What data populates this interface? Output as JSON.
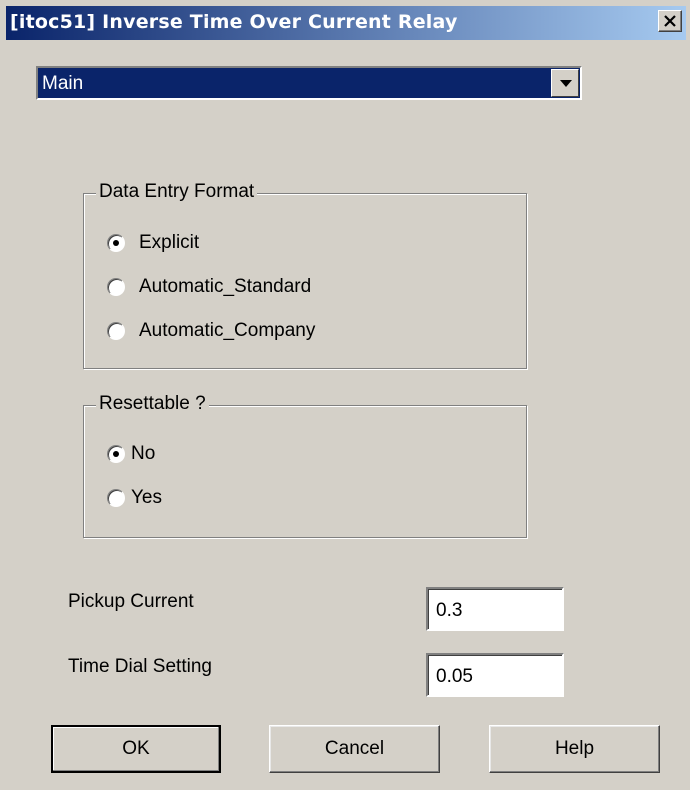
{
  "window": {
    "title": "[itoc51] Inverse Time Over Current Relay"
  },
  "page_selector": {
    "value": "Main"
  },
  "data_entry_format": {
    "label": "Data Entry Format",
    "options": [
      {
        "label": "Explicit",
        "checked": true
      },
      {
        "label": "Automatic_Standard",
        "checked": false
      },
      {
        "label": "Automatic_Company",
        "checked": false
      }
    ]
  },
  "resettable": {
    "label": "Resettable ?",
    "options": [
      {
        "label": "No",
        "checked": true
      },
      {
        "label": "Yes",
        "checked": false
      }
    ]
  },
  "fields": {
    "pickup_current": {
      "label": "Pickup Current",
      "value": "0.3"
    },
    "time_dial_setting": {
      "label": "Time Dial Setting",
      "value": "0.05"
    }
  },
  "buttons": {
    "ok": "OK",
    "cancel": "Cancel",
    "help": "Help"
  },
  "icons": {
    "close": "close-icon",
    "dropdown": "chevron-down-icon"
  }
}
